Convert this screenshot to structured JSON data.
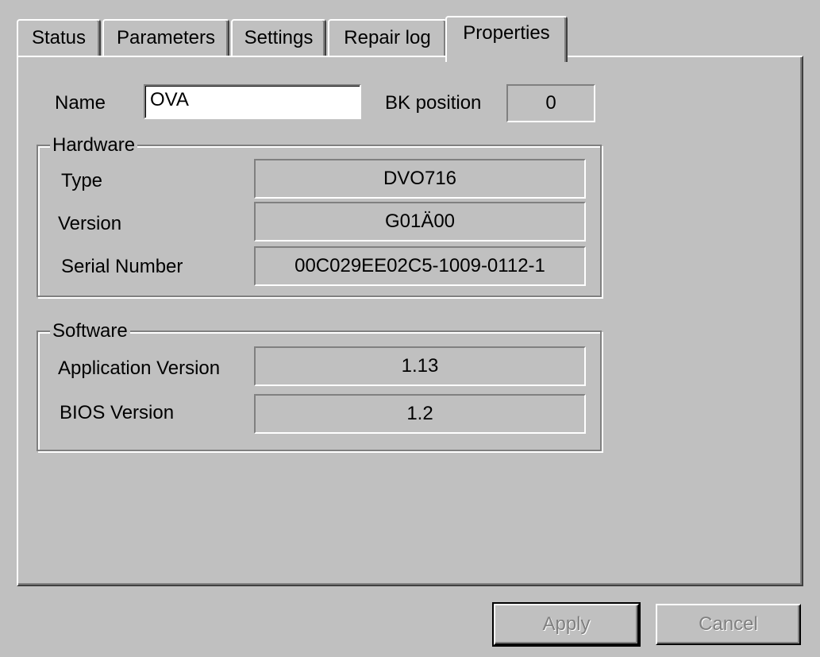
{
  "tabs": [
    {
      "label": "Status"
    },
    {
      "label": "Parameters"
    },
    {
      "label": "Settings"
    },
    {
      "label": "Repair log"
    },
    {
      "label": "Properties",
      "active": true
    }
  ],
  "name_label": "Name",
  "name_value": "OVA",
  "bk_position_label": "BK position",
  "bk_position_value": "0",
  "hardware": {
    "title": "Hardware",
    "type_label": "Type",
    "type_value": "DVO716",
    "version_label": "Version",
    "version_value": "G01Ä00",
    "serial_label": "Serial Number",
    "serial_value": "00C029EE02C5-1009-0112-1"
  },
  "software": {
    "title": "Software",
    "app_version_label": "Application Version",
    "app_version_value": "1.13",
    "bios_version_label": "BIOS Version",
    "bios_version_value": "1.2"
  },
  "buttons": {
    "apply": "Apply",
    "cancel": "Cancel"
  },
  "colors": {
    "face": "#c0c0c0",
    "highlight": "#ffffff",
    "shadow": "#808080",
    "dark_shadow": "#404040",
    "disabled_text": "#808080"
  }
}
